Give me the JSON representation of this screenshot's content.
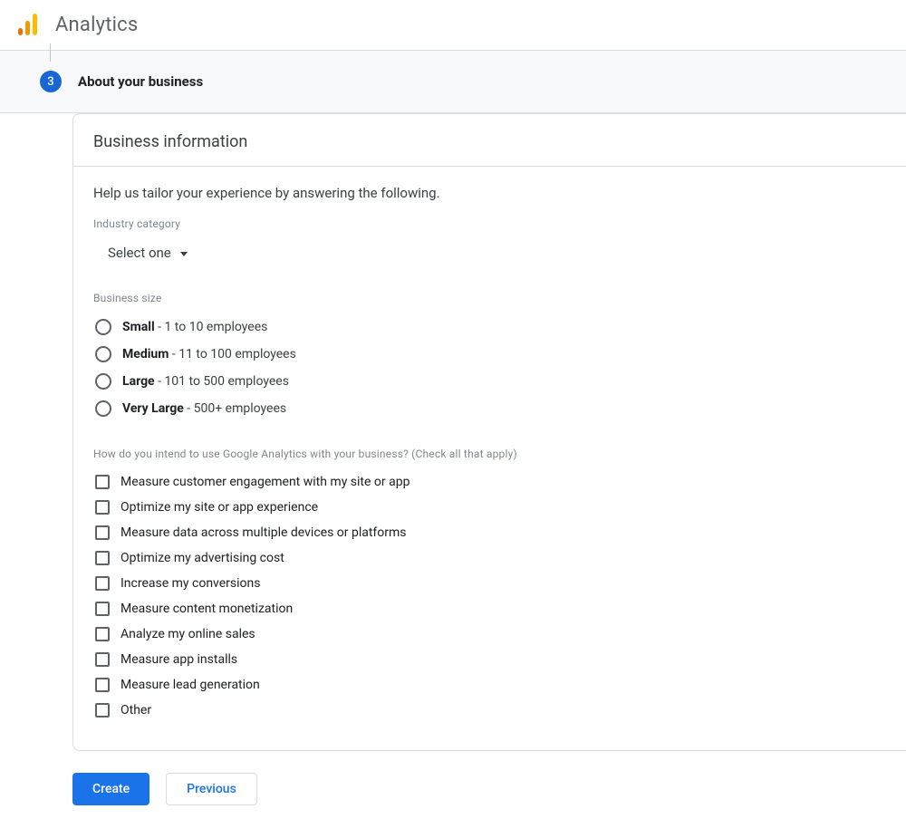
{
  "header": {
    "app_title": "Analytics"
  },
  "step": {
    "number": "3",
    "title": "About your business"
  },
  "card": {
    "title": "Business information",
    "help": "Help us tailor your experience by answering the following.",
    "industry": {
      "label": "Industry category",
      "select_placeholder": "Select one"
    },
    "size": {
      "label": "Business size",
      "options": [
        {
          "main": "Small",
          "detail": " - 1 to 10 employees"
        },
        {
          "main": "Medium",
          "detail": " - 11 to 100 employees"
        },
        {
          "main": "Large",
          "detail": " - 101 to 500 employees"
        },
        {
          "main": "Very Large",
          "detail": " - 500+ employees"
        }
      ]
    },
    "intent": {
      "label": "How do you intend to use Google Analytics with your business? (Check all that apply)",
      "options": [
        "Measure customer engagement with my site or app",
        "Optimize my site or app experience",
        "Measure data across multiple devices or platforms",
        "Optimize my advertising cost",
        "Increase my conversions",
        "Measure content monetization",
        "Analyze my online sales",
        "Measure app installs",
        "Measure lead generation",
        "Other"
      ]
    }
  },
  "buttons": {
    "create": "Create",
    "previous": "Previous"
  }
}
